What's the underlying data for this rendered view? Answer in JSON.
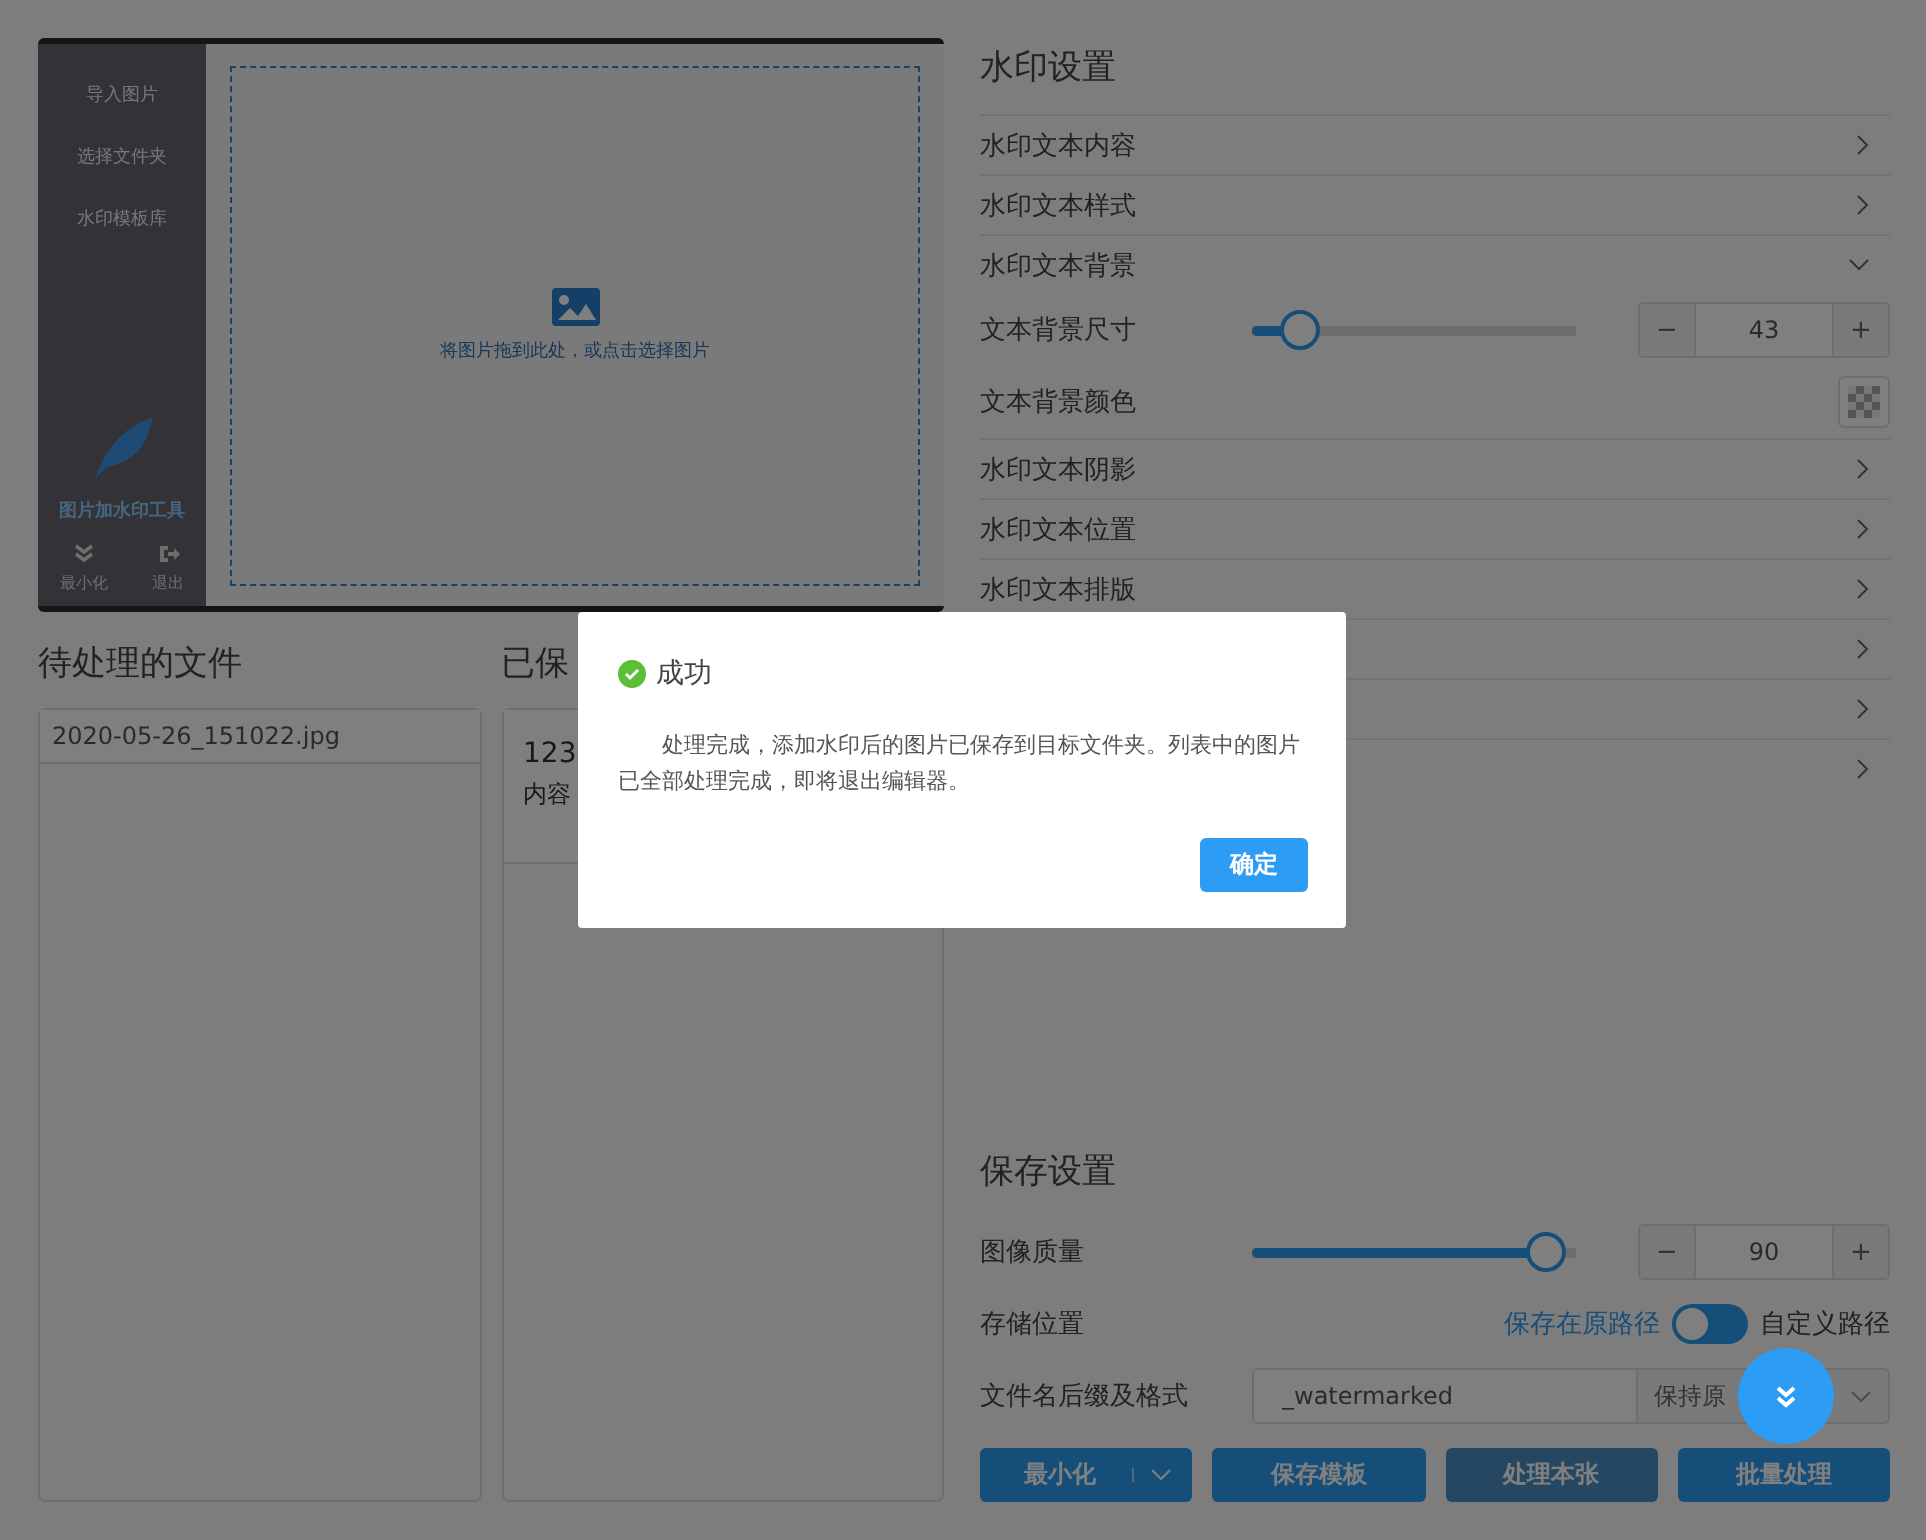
{
  "sidebar": {
    "items": [
      {
        "label": "导入图片"
      },
      {
        "label": "选择文件夹"
      },
      {
        "label": "水印模板库"
      }
    ],
    "brand": "图片加水印工具",
    "actions": [
      {
        "label": "最小化"
      },
      {
        "label": "退出"
      }
    ]
  },
  "drop_zone": {
    "hint": "将图片拖到此处，或点击选择图片"
  },
  "pending": {
    "title": "待处理的文件",
    "files": [
      "2020-05-26_151022.jpg"
    ]
  },
  "saved": {
    "title": "已保",
    "item_name": "123",
    "item_detail": "内容"
  },
  "watermark_settings": {
    "title": "水印设置",
    "sections": [
      {
        "label": "水印文本内容",
        "expanded": false
      },
      {
        "label": "水印文本样式",
        "expanded": false
      },
      {
        "label": "水印文本背景",
        "expanded": true,
        "controls": [
          {
            "kind": "slider",
            "label": "文本背景尺寸",
            "level": 0.14,
            "value": "43",
            "minus": "−",
            "plus": "+"
          },
          {
            "kind": "color",
            "label": "文本背景颜色"
          }
        ]
      },
      {
        "label": "水印文本阴影",
        "expanded": false
      },
      {
        "label": "水印文本位置",
        "expanded": false
      },
      {
        "label": "水印文本排版",
        "expanded": false
      },
      {
        "expanded": false
      },
      {
        "expanded": false
      },
      {
        "expanded": false
      }
    ]
  },
  "save_settings": {
    "title": "保存设置",
    "quality": {
      "label": "图像质量",
      "level": 0.9,
      "value": "90",
      "minus": "−",
      "plus": "+"
    },
    "location": {
      "label": "存储位置",
      "option_a": "保存在原路径",
      "option_b": "自定义路径",
      "on": false
    },
    "filename": {
      "label": "文件名后缀及格式",
      "value": "_watermarked",
      "format": "保持原"
    },
    "buttons": [
      {
        "label": "最小化",
        "kind": "split",
        "disabled": false
      },
      {
        "label": "保存模板",
        "kind": "plain",
        "disabled": false
      },
      {
        "label": "处理本张",
        "kind": "plain",
        "disabled": true
      },
      {
        "label": "批量处理",
        "kind": "plain",
        "disabled": false
      }
    ]
  },
  "dialog": {
    "title": "成功",
    "message": "处理完成，添加水印后的图片已保存到目标文件夹。列表中的图片已全部处理完成，即将退出编辑器。",
    "confirm": "确定"
  }
}
